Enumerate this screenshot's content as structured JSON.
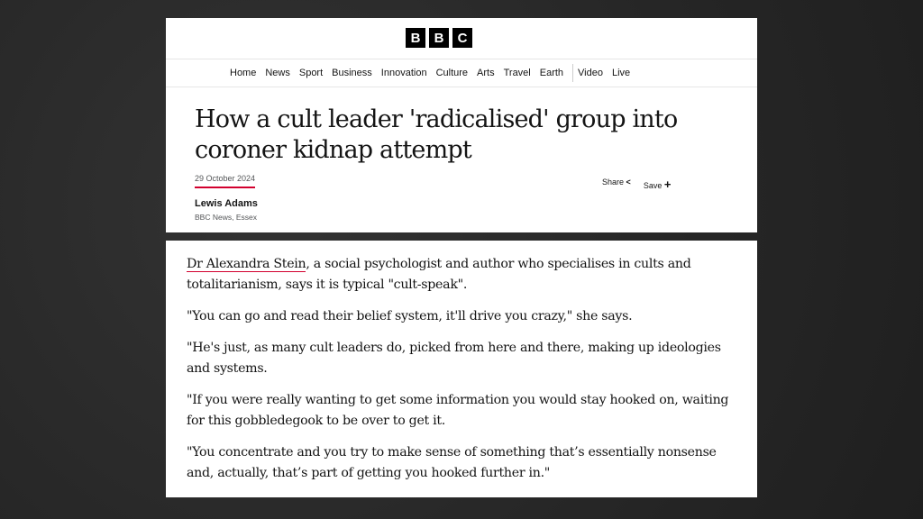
{
  "logo": [
    "B",
    "B",
    "C"
  ],
  "nav": [
    "Home",
    "News",
    "Sport",
    "Business",
    "Innovation",
    "Culture",
    "Arts",
    "Travel",
    "Earth",
    "Video",
    "Live"
  ],
  "article": {
    "title": "How a cult leader 'radicalised' group into coroner kidnap attempt",
    "date": "29 October 2024",
    "share": "Share",
    "save": "Save",
    "author": "Lewis Adams",
    "location": "BBC News, Essex"
  },
  "body": {
    "link": "Dr Alexandra Stein",
    "p0_rest": ", a social psychologist and author who specialises in cults and totalitarianism, says it is typical \"cult-speak\".",
    "paragraphs": [
      "\"You can go and read their belief system, it'll drive you crazy,\" she says.",
      "\"He's just, as many cult leaders do, picked from here and there, making up ideologies and systems.",
      "\"If you were really wanting to get some information you would stay hooked on, waiting for this gobbledegook to be over to get it.",
      "\"You concentrate and you try to make sense of something that’s essentially nonsense and, actually, that’s part of getting you hooked further in.\""
    ]
  },
  "colors": {
    "accent": "#d2002e"
  }
}
